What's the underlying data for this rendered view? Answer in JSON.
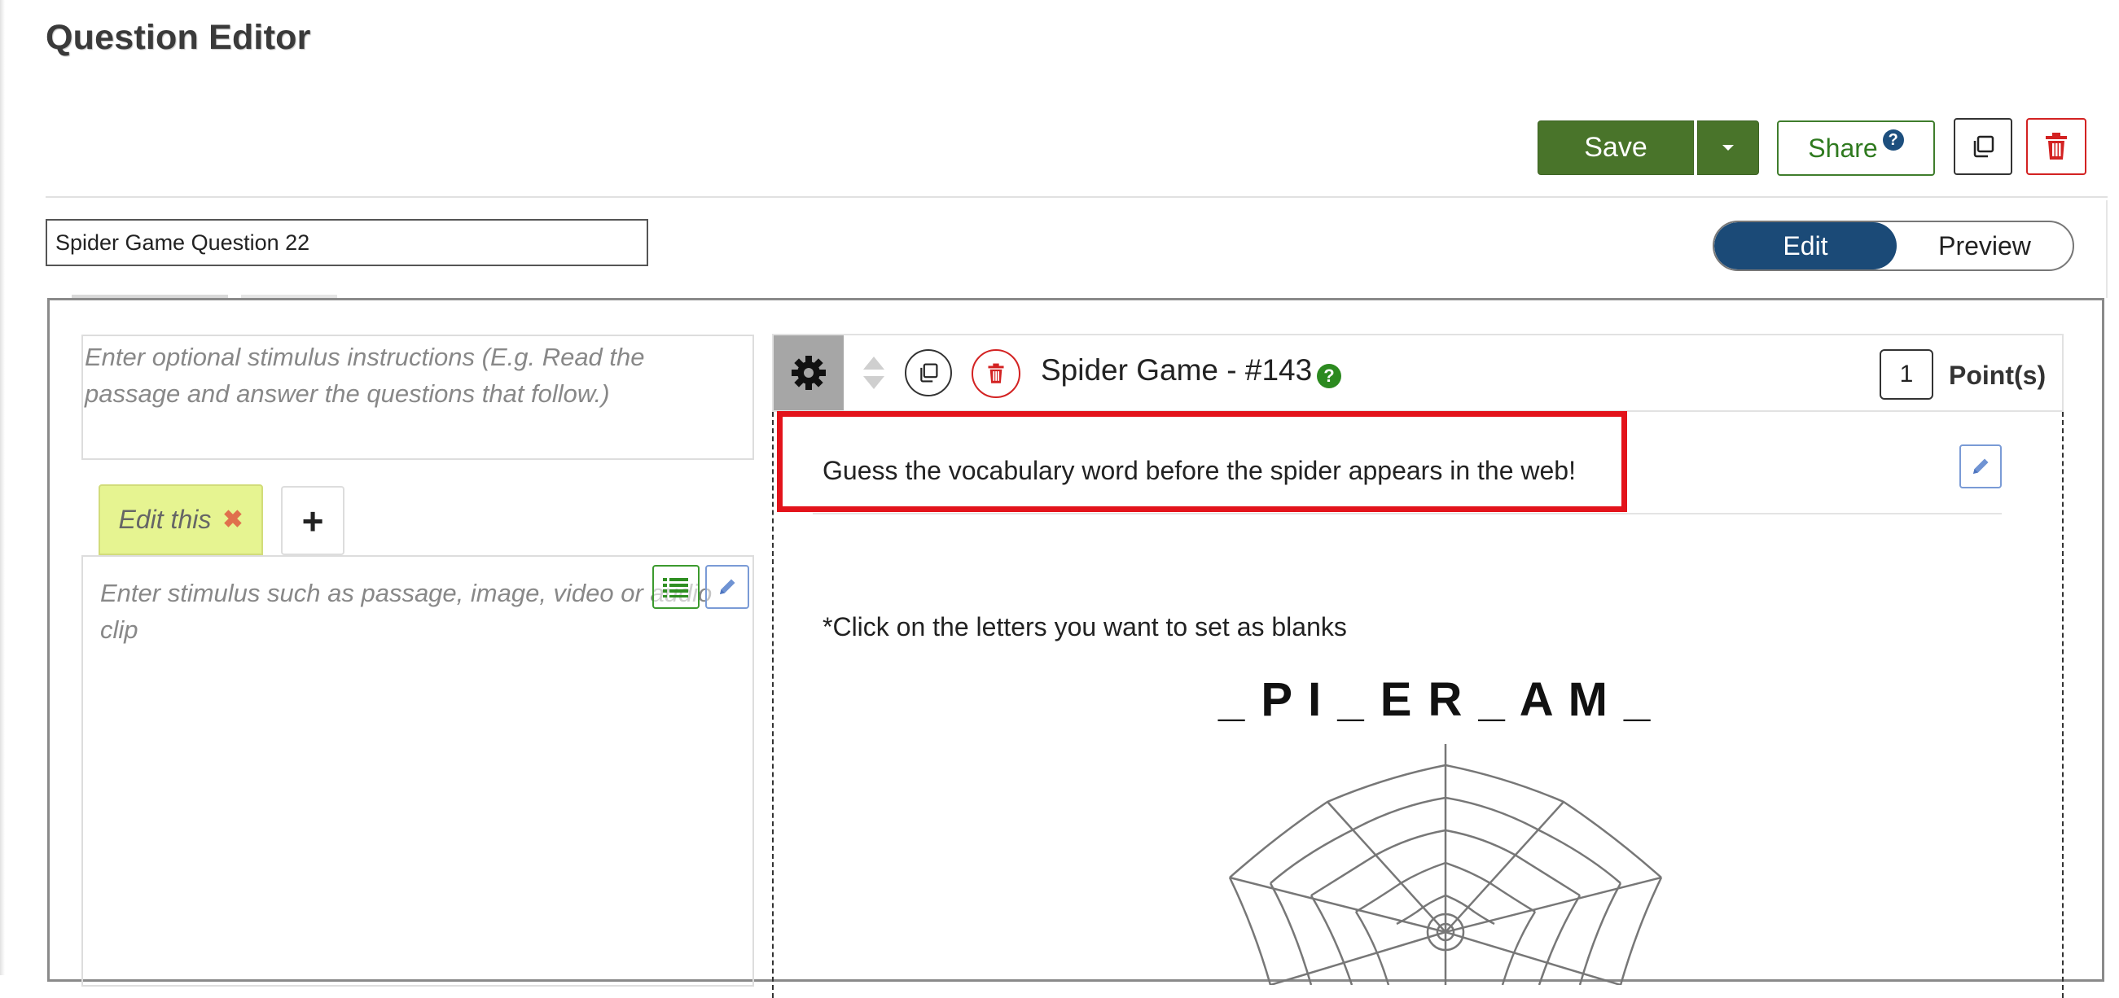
{
  "page": {
    "title": "Question Editor"
  },
  "toolbar": {
    "save_label": "Save",
    "share_label": "Share",
    "share_help": "?"
  },
  "question": {
    "name_value": "Spider Game Question 22"
  },
  "view_toggle": {
    "edit_label": "Edit",
    "preview_label": "Preview",
    "active": "Edit"
  },
  "stimulus": {
    "instructions_placeholder": "Enter optional stimulus instructions (E.g. Read the passage and answer the questions that follow.)",
    "tab_label": "Edit this",
    "tab_close": "✖",
    "add_tab": "+",
    "content_placeholder": "Enter stimulus such as passage, image, video or audio clip"
  },
  "item": {
    "title": "Spider Game - #143",
    "help": "?",
    "points_value": "1",
    "points_label": "Point(s)",
    "prompt": "Guess the vocabulary word before the spider appears in the web!",
    "note": "*Click on the letters you want to set as blanks",
    "word_display": "_ P I _ E R _ A M _"
  },
  "colors": {
    "save_green": "#49742a",
    "toggle_blue": "#1b4a77",
    "delete_red": "#d32222",
    "highlight_red": "#e3131b",
    "tab_yellow": "#e6f491"
  },
  "icons": [
    "caret-down-icon",
    "help-icon",
    "copy-icon",
    "trash-icon",
    "gear-icon",
    "sort-arrows-icon",
    "list-icon",
    "pencil-icon",
    "spider-web-icon"
  ]
}
